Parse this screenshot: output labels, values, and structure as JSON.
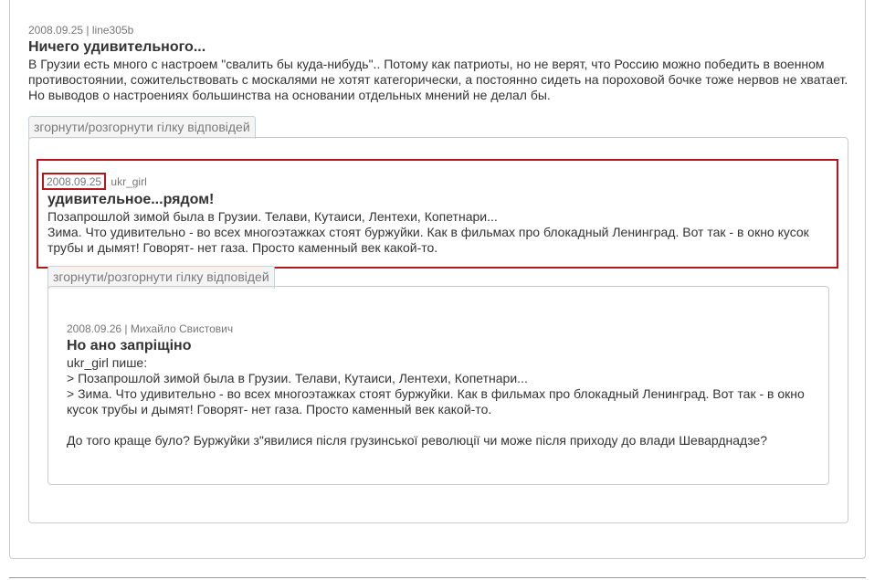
{
  "comment1": {
    "date": "2008.09.25",
    "separator": "|",
    "author": "line305b",
    "title": "Ничего удивительного...",
    "body": "В Грузии есть много с настроем \"свалить бы куда-нибудь\".. Потому как патриоты, но не верят, что Россию можно победить в военном противостоянии, сожительствовать с москалями не хотят категорически, а постоянно сидеть на пороховой бочке тоже нервов не хватает. Но выводов о настроениях большинства на основании отдельных мнений не делал бы."
  },
  "toggle_label_1": "згорнути/розгорнути гілку відповідей",
  "comment2": {
    "date": "2008.09.25",
    "author": "ukr_girl",
    "title": "удивительное...рядом!",
    "body": "Позапрошлой зимой была в Грузии. Телави, Кутаиси, Лентехи, Копетнари...\nЗима. Что удивительно - во всех многоэтажках стоят буржуйки. Как в фильмах про блокадный Ленинград. Вот так - в окно кусок трубы и дымят! Говорят- нет газа. Просто каменный век какой-то."
  },
  "toggle_label_2": "згорнути/розгорнути гілку відповідей",
  "comment3": {
    "date": "2008.09.26",
    "separator": "|",
    "author": "Михайло Свистович",
    "title": "Но ано запріщіно",
    "body": "ukr_girl пише:\n> Позапрошлой зимой была в Грузии. Телави, Кутаиси, Лентехи, Копетнари...\n> Зима. Что удивительно - во всех многоэтажках стоят буржуйки. Как в фильмах про блокадный Ленинград. Вот так - в окно кусок трубы и дымят! Говорят- нет газа. Просто каменный век какой-то.\n\nДо того краще було? Буржуйки з\"явилися після грузинської революції чи може після приходу до влади Шеварднадзе?"
  },
  "colors": {
    "highlight": "#b5151b",
    "border": "#cccccc",
    "tab_border": "#bcd3e6"
  }
}
